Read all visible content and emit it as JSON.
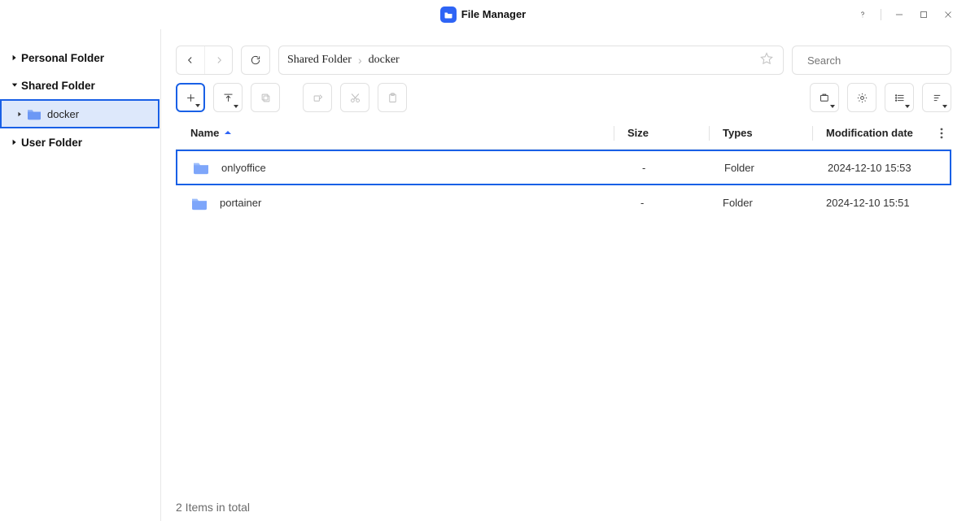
{
  "window": {
    "title": "File Manager"
  },
  "sidebar": {
    "items": [
      {
        "label": "Personal Folder",
        "expanded": false
      },
      {
        "label": "Shared Folder",
        "expanded": true,
        "children": [
          {
            "label": "docker",
            "selected": true
          }
        ]
      },
      {
        "label": "User Folder",
        "expanded": false
      }
    ]
  },
  "path": {
    "segments": [
      "Shared Folder",
      "docker"
    ]
  },
  "search": {
    "placeholder": "Search"
  },
  "table": {
    "headers": {
      "name": "Name",
      "size": "Size",
      "types": "Types",
      "date": "Modification date"
    },
    "rows": [
      {
        "name": "onlyoffice",
        "size": "-",
        "types": "Folder",
        "date": "2024-12-10 15:53",
        "selected": true
      },
      {
        "name": "portainer",
        "size": "-",
        "types": "Folder",
        "date": "2024-12-10 15:51",
        "selected": false
      }
    ]
  },
  "status": {
    "text": "2 Items in total"
  }
}
